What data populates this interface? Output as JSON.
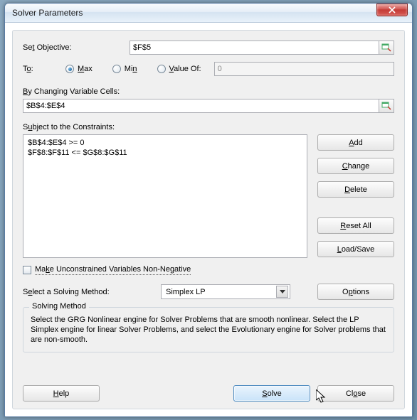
{
  "window": {
    "title": "Solver Parameters"
  },
  "objective": {
    "label_pre": "Se",
    "label_und": "t",
    "label_post": " Objective:",
    "value": "$F$5"
  },
  "to": {
    "label_pre": "T",
    "label_und": "o",
    "label_post": ":",
    "max_und": "M",
    "max_post": "ax",
    "min_pre": "Mi",
    "min_und": "n",
    "valueof_und": "V",
    "valueof_post": "alue Of:",
    "valueof_input": "0",
    "selected": "max"
  },
  "changing": {
    "label_und": "B",
    "label_post": "y Changing Variable Cells:",
    "value": "$B$4:$E$4"
  },
  "constraints": {
    "label_pre": "S",
    "label_und": "u",
    "label_post": "bject to the Constraints:",
    "items": [
      "$B$4:$E$4 >= 0",
      "$F$8:$F$11 <= $G$8:$G$11"
    ]
  },
  "buttons": {
    "add_und": "A",
    "add_post": "dd",
    "change_und": "C",
    "change_post": "hange",
    "delete_und": "D",
    "delete_post": "elete",
    "resetall_und": "R",
    "resetall_post": "eset All",
    "loadsave_und": "L",
    "loadsave_post": "oad/Save",
    "options_pre": "O",
    "options_und": "p",
    "options_post": "tions",
    "help_und": "H",
    "help_post": "elp",
    "solve_und": "S",
    "solve_post": "olve",
    "close_pre": "Cl",
    "close_und": "o",
    "close_post": "se"
  },
  "unconstrained": {
    "label_pre": "Ma",
    "label_und": "k",
    "label_post": "e Unconstrained Variables Non-Negative",
    "checked": false
  },
  "method": {
    "label_pre": "S",
    "label_und": "e",
    "label_post": "lect a Solving Method:",
    "value": "Simplex LP"
  },
  "groupbox": {
    "title": "Solving Method",
    "body": "Select the GRG Nonlinear engine for Solver Problems that are smooth nonlinear. Select the LP Simplex engine for linear Solver Problems, and select the Evolutionary engine for Solver problems that are non-smooth."
  }
}
